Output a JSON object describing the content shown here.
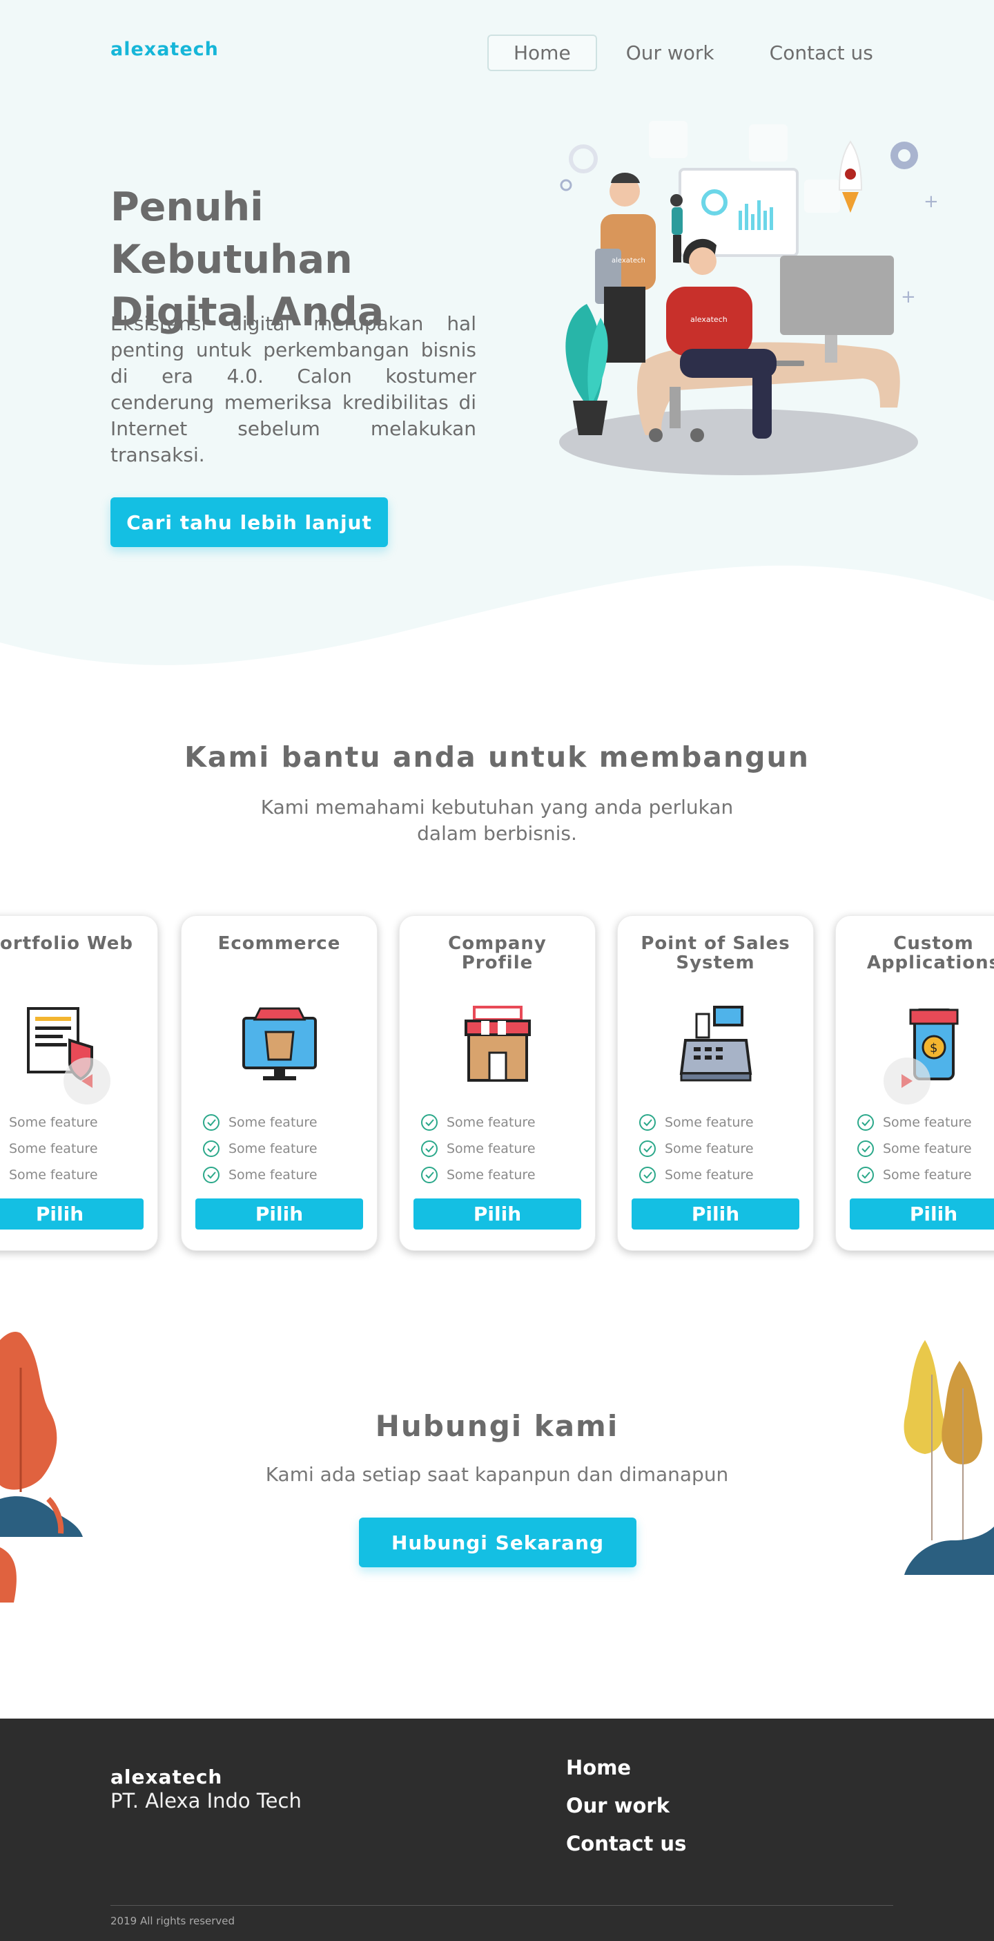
{
  "header": {
    "brand": "alexatech",
    "nav": [
      {
        "label": "Home",
        "active": true
      },
      {
        "label": "Our work",
        "active": false
      },
      {
        "label": "Contact us",
        "active": false
      }
    ]
  },
  "hero": {
    "title": "Penuhi Kebutuhan Digital Anda",
    "text": "Eksistensi digital merupakan hal penting untuk perkembangan bisnis di era 4.0. Calon kostumer cenderung memeriksa kredibilitas di Internet sebelum melakukan transaksi.",
    "cta_label": "Cari tahu lebih lanjut",
    "illustration": "office-team-illustration",
    "illustration_badge": "alexatech"
  },
  "services": {
    "title": "Kami bantu anda untuk membangun",
    "subtitle": "Kami memahami kebutuhan yang anda perlukan dalam berbisnis.",
    "cards": [
      {
        "title": "Portfolio Web",
        "icon": "portfolio-document-icon",
        "features": [
          "Some feature",
          "Some feature",
          "Some feature"
        ],
        "button": "Pilih"
      },
      {
        "title": "Ecommerce",
        "icon": "ecommerce-monitor-icon",
        "features": [
          "Some feature",
          "Some feature",
          "Some feature"
        ],
        "button": "Pilih"
      },
      {
        "title": "Company Profile",
        "icon": "storefront-icon",
        "features": [
          "Some feature",
          "Some feature",
          "Some feature"
        ],
        "button": "Pilih"
      },
      {
        "title": "Point of Sales System",
        "icon": "cash-register-icon",
        "features": [
          "Some feature",
          "Some feature",
          "Some feature"
        ],
        "button": "Pilih"
      },
      {
        "title": "Custom Applications",
        "icon": "mobile-shop-icon",
        "features": [
          "Some feature",
          "Some feature",
          "Some feature"
        ],
        "button": "Pilih"
      }
    ],
    "prev_icon": "carousel-prev-icon",
    "next_icon": "carousel-next-icon"
  },
  "contact": {
    "title": "Hubungi kami",
    "subtitle": "Kami ada setiap saat kapanpun dan dimanapun",
    "cta_label": "Hubungi Sekarang"
  },
  "footer": {
    "brand": "alexatech",
    "company": "PT. Alexa Indo Tech",
    "links": [
      "Home",
      "Our work",
      "Contact us"
    ],
    "copyright": "2019 All rights reserved"
  },
  "colors": {
    "accent": "#14bfe3",
    "brand": "#16b6d8",
    "hero_bg": "#f1f9f9",
    "footer_bg": "#2d2d2d",
    "check": "#2ba88a"
  }
}
